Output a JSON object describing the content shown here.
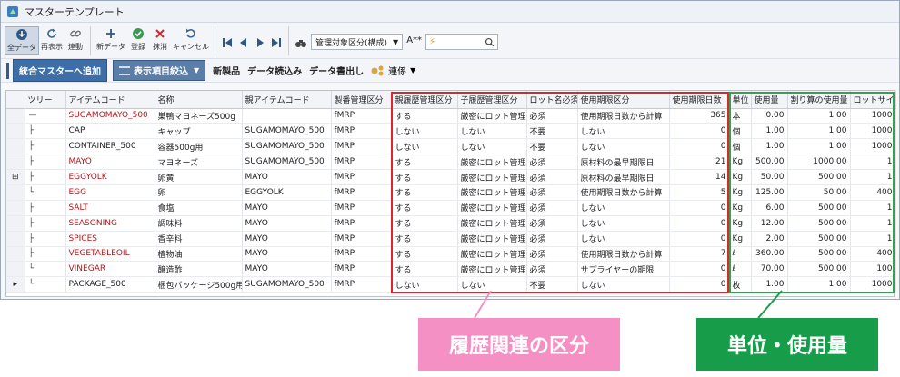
{
  "window": {
    "title": "マスターテンプレート"
  },
  "toolbar": {
    "all_data": "全データ",
    "redisplay": "再表示",
    "link": "連動",
    "new_data": "新データ",
    "register": "登録",
    "delete": "抹消",
    "cancel": "キャンセル",
    "combo_value": "管理対象区分(構成)",
    "font_size": "A**",
    "search_value": "⚡"
  },
  "toolbar2": {
    "add_master": "統合マスターへ追加",
    "filter_items": "表示項目絞込",
    "new_product": "新製品",
    "data_read": "データ読込み",
    "data_write": "データ書出し",
    "linkage": "連係"
  },
  "table": {
    "columns": [
      "",
      "ツリー",
      "アイテムコード",
      "名称",
      "親アイテムコード",
      "製番管理区分",
      "親履歴管理区分",
      "子履歴管理区分",
      "ロット名必須",
      "使用期限区分",
      "使用期限日数",
      "単位",
      "使用量",
      "割り算の使用量",
      "ロットサイズ"
    ],
    "rows": [
      {
        "sel": "",
        "tree": "—",
        "code": "SUGAMOMAYO_500",
        "code_red": true,
        "name": "巣鴨マヨネーズ500g",
        "parent": "",
        "mgmt": "fMRP",
        "parent_hist": "する",
        "child_hist": "厳密にロット管理",
        "lot_req": "必須",
        "expiry_type": "使用期限日数から計算",
        "expiry_days": "365",
        "unit": "本",
        "usage": "0.00",
        "div_usage": "1.00",
        "lot_size": "1000"
      },
      {
        "sel": "",
        "tree": "├",
        "code": "CAP",
        "code_red": false,
        "name": "キャップ",
        "parent": "SUGAMOMAYO_500",
        "mgmt": "fMRP",
        "parent_hist": "しない",
        "child_hist": "しない",
        "lot_req": "不要",
        "expiry_type": "しない",
        "expiry_days": "0",
        "unit": "個",
        "usage": "1.00",
        "div_usage": "1.00",
        "lot_size": "1000"
      },
      {
        "sel": "",
        "tree": "├",
        "code": "CONTAINER_500",
        "code_red": false,
        "name": "容器500g用",
        "parent": "SUGAMOMAYO_500",
        "mgmt": "fMRP",
        "parent_hist": "しない",
        "child_hist": "しない",
        "lot_req": "不要",
        "expiry_type": "しない",
        "expiry_days": "0",
        "unit": "個",
        "usage": "1.00",
        "div_usage": "1.00",
        "lot_size": "1000"
      },
      {
        "sel": "",
        "tree": "├",
        "code": "MAYO",
        "code_red": true,
        "name": "マヨネーズ",
        "parent": "SUGAMOMAYO_500",
        "mgmt": "fMRP",
        "parent_hist": "する",
        "child_hist": "厳密にロット管理",
        "lot_req": "必須",
        "expiry_type": "原材料の最早期限日",
        "expiry_days": "21",
        "unit": "Kg",
        "usage": "500.00",
        "div_usage": "1000.00",
        "lot_size": "1"
      },
      {
        "sel": "⊞",
        "tree": "  ├",
        "code": "EGGYOLK",
        "code_red": true,
        "name": "卵黄",
        "parent": "MAYO",
        "mgmt": "fMRP",
        "parent_hist": "する",
        "child_hist": "厳密にロット管理",
        "lot_req": "必須",
        "expiry_type": "原材料の最早期限日",
        "expiry_days": "14",
        "unit": "Kg",
        "usage": "50.00",
        "div_usage": "500.00",
        "lot_size": "1"
      },
      {
        "sel": "",
        "tree": "    └",
        "code": "EGG",
        "code_red": true,
        "name": "卵",
        "parent": "EGGYOLK",
        "mgmt": "fMRP",
        "parent_hist": "する",
        "child_hist": "厳密にロット管理",
        "lot_req": "必須",
        "expiry_type": "使用期限日数から計算",
        "expiry_days": "5",
        "unit": "Kg",
        "usage": "125.00",
        "div_usage": "50.00",
        "lot_size": "400"
      },
      {
        "sel": "",
        "tree": "  ├",
        "code": "SALT",
        "code_red": true,
        "name": "食塩",
        "parent": "MAYO",
        "mgmt": "fMRP",
        "parent_hist": "する",
        "child_hist": "厳密にロット管理",
        "lot_req": "必須",
        "expiry_type": "しない",
        "expiry_days": "0",
        "unit": "Kg",
        "usage": "6.00",
        "div_usage": "500.00",
        "lot_size": "1"
      },
      {
        "sel": "",
        "tree": "  ├",
        "code": "SEASONING",
        "code_red": true,
        "name": "調味料",
        "parent": "MAYO",
        "mgmt": "fMRP",
        "parent_hist": "する",
        "child_hist": "厳密にロット管理",
        "lot_req": "必須",
        "expiry_type": "しない",
        "expiry_days": "0",
        "unit": "Kg",
        "usage": "12.00",
        "div_usage": "500.00",
        "lot_size": "1"
      },
      {
        "sel": "",
        "tree": "  ├",
        "code": "SPICES",
        "code_red": true,
        "name": "香辛料",
        "parent": "MAYO",
        "mgmt": "fMRP",
        "parent_hist": "する",
        "child_hist": "厳密にロット管理",
        "lot_req": "必須",
        "expiry_type": "しない",
        "expiry_days": "0",
        "unit": "Kg",
        "usage": "2.00",
        "div_usage": "500.00",
        "lot_size": "1"
      },
      {
        "sel": "",
        "tree": "  ├",
        "code": "VEGETABLEOIL",
        "code_red": true,
        "name": "植物油",
        "parent": "MAYO",
        "mgmt": "fMRP",
        "parent_hist": "する",
        "child_hist": "厳密にロット管理",
        "lot_req": "必須",
        "expiry_type": "使用期限日数から計算",
        "expiry_days": "7",
        "unit": "ℓ",
        "usage": "360.00",
        "div_usage": "500.00",
        "lot_size": "400"
      },
      {
        "sel": "",
        "tree": "  └",
        "code": "VINEGAR",
        "code_red": true,
        "name": "醸造酢",
        "parent": "MAYO",
        "mgmt": "fMRP",
        "parent_hist": "する",
        "child_hist": "厳密にロット管理",
        "lot_req": "必須",
        "expiry_type": "サプライヤーの期限",
        "expiry_days": "0",
        "unit": "ℓ",
        "usage": "70.00",
        "div_usage": "500.00",
        "lot_size": "100"
      },
      {
        "sel": "▸",
        "tree": "└",
        "code": "PACKAGE_500",
        "code_red": false,
        "name": "梱包パッケージ500g用",
        "parent": "SUGAMOMAYO_500",
        "mgmt": "fMRP",
        "parent_hist": "しない",
        "child_hist": "しない",
        "lot_req": "不要",
        "expiry_type": "しない",
        "expiry_days": "0",
        "unit": "枚",
        "usage": "1.00",
        "div_usage": "1.00",
        "lot_size": "1000"
      }
    ]
  },
  "annotations": {
    "history_label": "履歴関連の区分",
    "unit_label": "単位・使用量"
  }
}
